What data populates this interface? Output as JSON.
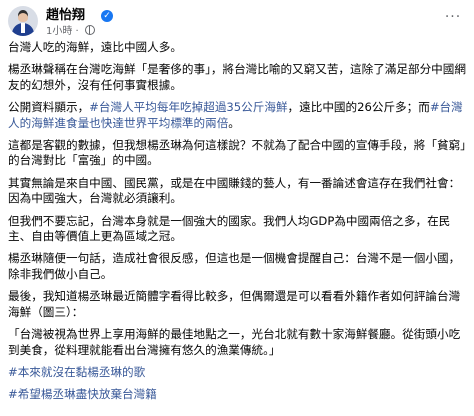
{
  "post": {
    "author": "趙怡翔",
    "time": "1小時",
    "paragraphs": {
      "p1": "台灣人吃的海鮮，遠比中國人多。",
      "p2": "楊丞琳聲稱在台灣吃海鮮「是奢侈的事」，將台灣比喻的又窮又苦，這除了滿足部分中國網友的幻想外，沒有任何事實根據。",
      "p3a": "公開資料顯示，",
      "p3tag1": "#台灣人平均每年吃掉超過35公斤海鮮",
      "p3b": "，遠比中國的26公斤多；而",
      "p3tag2": "#台灣人的海鮮進食量也快達世界平均標準的兩倍",
      "p3c": "。",
      "p4": "這都是客觀的數據，但我想楊丞琳為何這樣說？不就為了配合中國的宣傳手段，將「貧窮」的台灣對比「富強」的中國。",
      "p5": "其實無論是來自中國、國民黨，或是在中國賺錢的藝人，有一番論述會這存在我們社會：因為中國強大，台灣就必須讓利。",
      "p6": "但我們不要忘記，台灣本身就是一個強大的國家。我們人均GDP為中國兩倍之多，在民主、自由等價值上更為區域之冠。",
      "p7": "楊丞琳隨便一句話，造成社會很反感，但這也是一個機會提醒自己：台灣不是一個小國，除非我們做小自己。",
      "p8": "最後，我知道楊丞琳最近簡體字看得比較多，但偶爾還是可以看看外籍作者如何評論台灣海鮮（圖三）：",
      "p9": "「台灣被視為世界上享用海鮮的最佳地點之一，光台北就有數十家海鮮餐廳。從街頭小吃到美食，從料理就能看出台灣擁有悠久的漁業傳統。」"
    },
    "hashtags": {
      "h1": "#本來就沒在黏楊丞琳的歌",
      "h2": "#希望楊丞琳盡快放棄台灣籍"
    }
  },
  "icons": {
    "verified": "verified-badge-icon",
    "privacy": "globe-icon",
    "more": "more-options-icon"
  },
  "colors": {
    "link": "#385898",
    "meta": "#65676b",
    "verified": "#1877f2"
  }
}
